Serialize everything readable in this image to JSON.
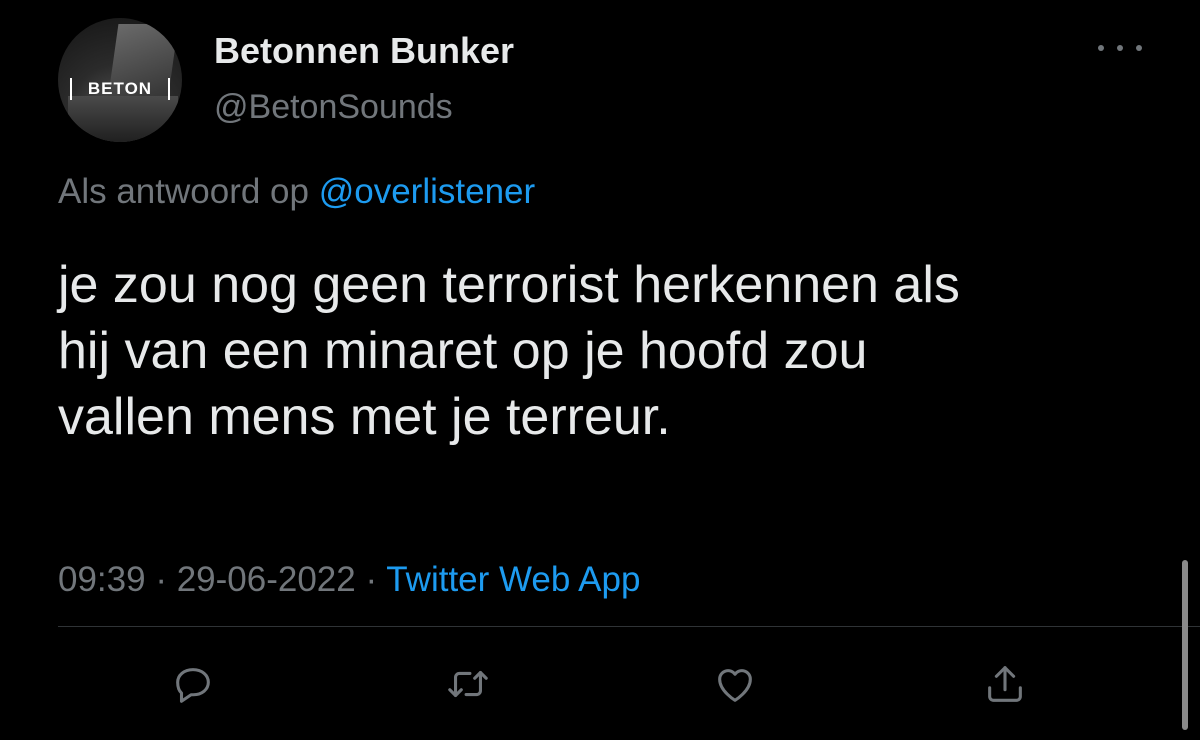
{
  "user": {
    "display_name": "Betonnen Bunker",
    "handle": "@BetonSounds",
    "avatar_logo_text": "BETON"
  },
  "reply_context": {
    "prefix": "Als antwoord op ",
    "mention": "@overlistener"
  },
  "tweet": {
    "line1": "je zou nog geen terrorist herkennen als",
    "line2": "hij van een minaret op je hoofd zou",
    "line3": "vallen mens met je terreur."
  },
  "meta": {
    "time": "09:39",
    "separator": " · ",
    "date": "29-06-2022",
    "source": "Twitter Web App"
  },
  "actions": [
    {
      "icon": "reply-icon"
    },
    {
      "icon": "retweet-icon"
    },
    {
      "icon": "like-icon"
    },
    {
      "icon": "share-icon"
    }
  ],
  "colors": {
    "background": "#000000",
    "text_primary": "#e7e9ea",
    "text_secondary": "#71767b",
    "accent": "#1d9bf0"
  }
}
